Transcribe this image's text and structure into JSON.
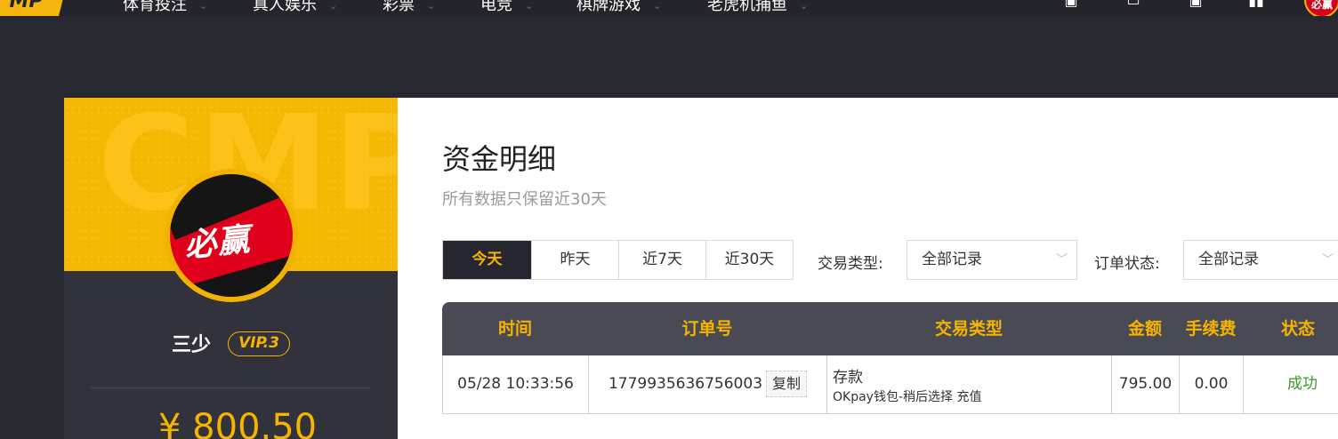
{
  "brand": {
    "logo_text": "MP"
  },
  "nav": {
    "items": [
      "体育投注",
      "真人娱乐",
      "彩票",
      "电竞",
      "棋牌游戏",
      "老虎机捕鱼"
    ]
  },
  "profile": {
    "avatar_text": "必赢",
    "watermark": "CMP",
    "username": "三少",
    "vip": "VIP.3",
    "balance": "¥ 800.50"
  },
  "page": {
    "title": "资金明细",
    "subtitle": "所有数据只保留近30天"
  },
  "filters": {
    "date_tabs": [
      "今天",
      "昨天",
      "近7天",
      "近30天"
    ],
    "active_tab": "今天",
    "type_label": "交易类型:",
    "type_value": "全部记录",
    "status_label": "订单状态:",
    "status_value": "全部记录"
  },
  "table": {
    "headers": [
      "时间",
      "订单号",
      "交易类型",
      "金额",
      "手续费",
      "状态"
    ],
    "rows": [
      {
        "time": "05/28 10:33:56",
        "order_no": "1779935636756003",
        "copy_label": "复制",
        "type": "存款",
        "type_detail": "OKpay钱包-稍后选择 充值",
        "amount": "795.00",
        "fee": "0.00",
        "status": "成功"
      }
    ]
  },
  "colors": {
    "accent": "#f5b400",
    "dark": "#282830",
    "success": "#3a9a2a"
  }
}
